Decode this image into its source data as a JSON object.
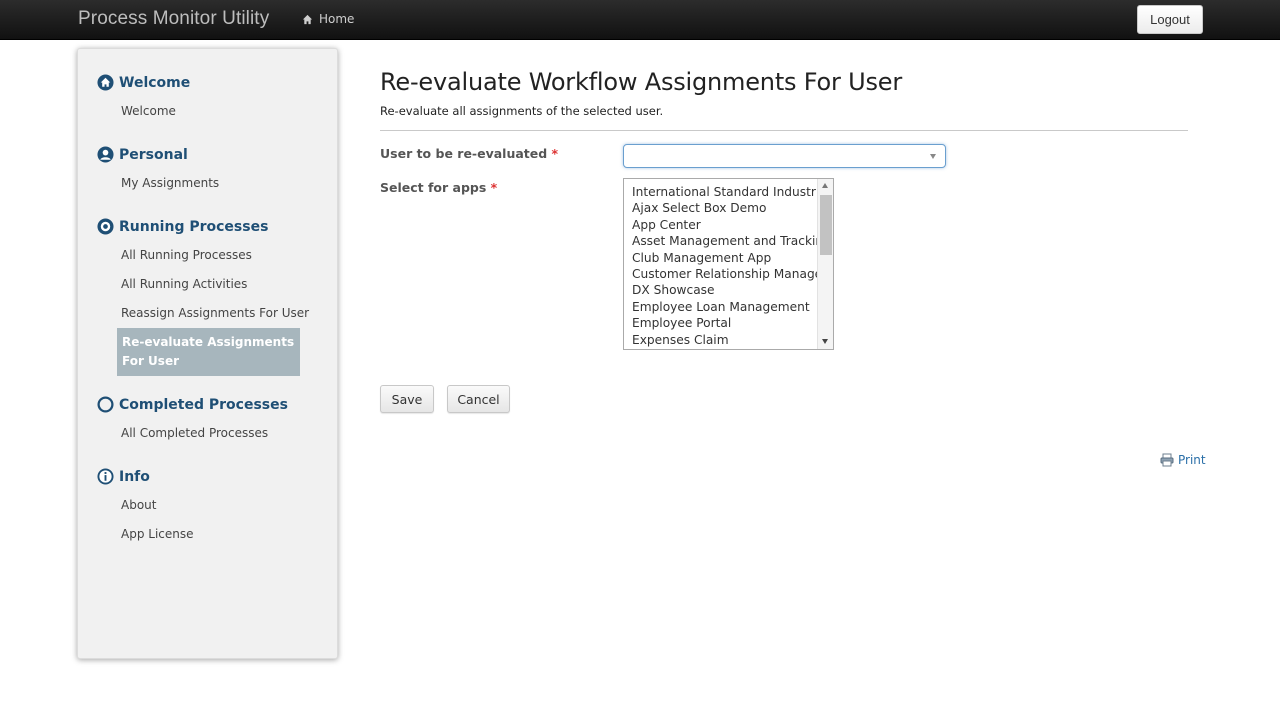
{
  "navbar": {
    "brand": "Process Monitor Utility",
    "home_label": "Home",
    "logout_label": "Logout"
  },
  "sidebar": {
    "sections": [
      {
        "title": "Welcome",
        "icon": "home-circle-icon",
        "items": [
          "Welcome"
        ]
      },
      {
        "title": "Personal",
        "icon": "user-circle-icon",
        "items": [
          "My Assignments"
        ]
      },
      {
        "title": "Running Processes",
        "icon": "target-circle-icon",
        "items": [
          "All Running Processes",
          "All Running Activities",
          "Reassign Assignments For User"
        ]
      },
      {
        "title": "Completed Processes",
        "icon": "ring-icon",
        "items": [
          "All Completed Processes"
        ]
      },
      {
        "title": "Info",
        "icon": "info-circle-icon",
        "items": [
          "About",
          "App License"
        ]
      }
    ],
    "active_item_line1": "Re-evaluate Assignments",
    "active_item_line2": "For User"
  },
  "main": {
    "title": "Re-evaluate Workflow Assignments For User",
    "subtitle": "Re-evaluate all assignments of the selected user.",
    "user_label": "User to be re-evaluated",
    "apps_label": "Select for apps",
    "required_mark": "*",
    "user_value": "",
    "apps_options": [
      "International Standard Industrial Classification",
      "Ajax Select Box Demo",
      "App Center",
      "Asset Management and Tracking",
      "Club Management App",
      "Customer Relationship Management",
      "DX Showcase",
      "Employee Loan Management",
      "Employee Portal",
      "Expenses Claim"
    ],
    "save_label": "Save",
    "cancel_label": "Cancel",
    "print_label": "Print"
  },
  "colors": {
    "section_title": "#1f4f75",
    "active_item_bg": "#a7b6bd",
    "required": "#dd3333",
    "link": "#2a6fa8"
  }
}
